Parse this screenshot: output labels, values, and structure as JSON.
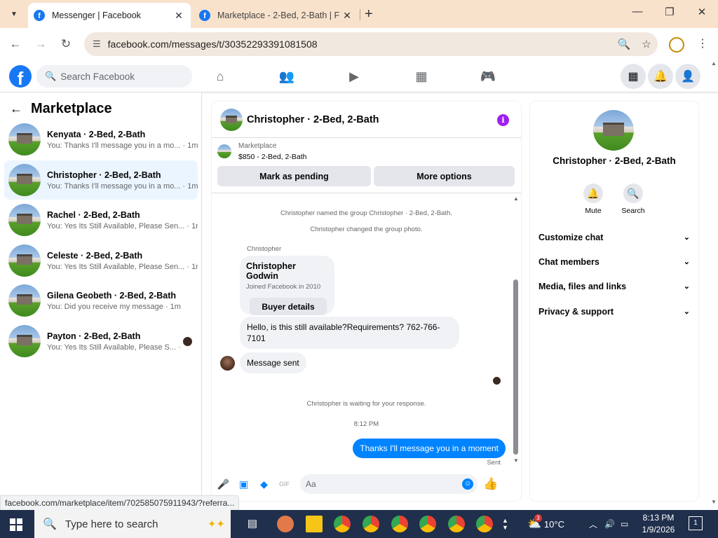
{
  "browser": {
    "tabs": [
      {
        "title": "Messenger | Facebook",
        "active": true
      },
      {
        "title": "Marketplace - 2-Bed, 2-Bath | F",
        "active": false
      }
    ],
    "url": "facebook.com/messages/t/30352293391081508",
    "status_url": "facebook.com/marketplace/item/702585075911943/?referra..."
  },
  "fb": {
    "search_placeholder": "Search Facebook"
  },
  "left": {
    "title": "Marketplace",
    "conversations": [
      {
        "name": "Kenyata · 2-Bed, 2-Bath",
        "preview": "You: Thanks I'll message you in a mo... · 1m",
        "selected": false
      },
      {
        "name": "Christopher · 2-Bed, 2-Bath",
        "preview": "You: Thanks I'll message you in a mo... · 1m",
        "selected": true
      },
      {
        "name": "Rachel · 2-Bed, 2-Bath",
        "preview": "You: Yes Its Still Available, Please Sen... · 1m",
        "selected": false
      },
      {
        "name": "Celeste · 2-Bed, 2-Bath",
        "preview": "You: Yes Its Still Available, Please Sen... · 1m",
        "selected": false
      },
      {
        "name": "Gilena Geobeth · 2-Bed, 2-Bath",
        "preview": "You: Did you receive my message · 1m",
        "selected": false
      },
      {
        "name": "Payton · 2-Bed, 2-Bath",
        "preview": "You: Yes Its Still Available, Please S... · 3w",
        "selected": false
      }
    ]
  },
  "chat": {
    "title": "Christopher · 2-Bed, 2-Bath",
    "listing_label": "Marketplace",
    "listing_info": "$850 - 2-Bed, 2-Bath",
    "mark_pending": "Mark as pending",
    "more_options": "More options",
    "sys1": "Christopher named the group Christopher · 2-Bed, 2-Bath.",
    "sys2": "Christopher changed the group photo.",
    "sender": "Christopher",
    "card_name": "Christopher Godwin",
    "card_sub": "Joined Facebook in 2010",
    "card_btn": "Buyer details",
    "msg1": "Hello, is this still available?Requirements? 762-766-7101",
    "msg2": "Message sent",
    "waiting": "Christopher is waiting for your response.",
    "time": "8:12 PM",
    "my_msg": "Thanks I'll message you in a moment",
    "sent": "Sent",
    "input_placeholder": "Aa"
  },
  "right": {
    "name": "Christopher · 2-Bed, 2-Bath",
    "mute": "Mute",
    "search": "Search",
    "sections": [
      "Customize chat",
      "Chat members",
      "Media, files and links",
      "Privacy & support"
    ]
  },
  "taskbar": {
    "search": "Type here to search",
    "weather": "10°C",
    "time": "8:13 PM",
    "date": "1/9/2026",
    "badge": "3"
  }
}
